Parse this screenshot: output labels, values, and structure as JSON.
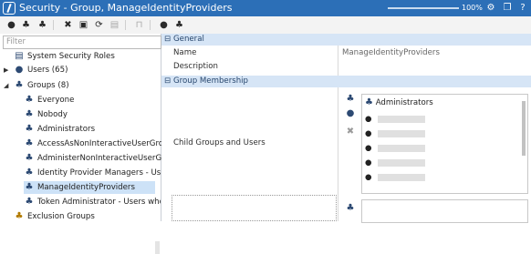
{
  "window": {
    "title": "Security - Group, ManageIdentityProviders",
    "zoom": "100%"
  },
  "toolbar": {
    "buttons": [
      {
        "name": "new-user",
        "icon": "user-icon"
      },
      {
        "name": "new-group",
        "icon": "group-icon"
      },
      {
        "name": "new-exclusion-group",
        "icon": "group-icon"
      },
      {
        "name": "delete",
        "icon": "close-icon"
      },
      {
        "name": "properties",
        "icon": "document-icon"
      },
      {
        "name": "refresh",
        "icon": "refresh-icon"
      },
      {
        "name": "save",
        "icon": "save-icon"
      },
      {
        "name": "lock",
        "icon": "lock-icon"
      },
      {
        "name": "user-settings",
        "icon": "user-icon"
      },
      {
        "name": "groups-settings",
        "icon": "group-icon"
      }
    ]
  },
  "tree": {
    "filter_placeholder": "Filter",
    "items": [
      {
        "label": "System Security Roles",
        "icon": "roles-icon"
      },
      {
        "label": "Users (65)",
        "icon": "user-icon"
      },
      {
        "label": "Groups (8)",
        "icon": "group-icon"
      },
      {
        "label": "Everyone",
        "icon": "group-icon"
      },
      {
        "label": "Nobody",
        "icon": "group-icon"
      },
      {
        "label": "Administrators",
        "icon": "group-icon"
      },
      {
        "label": "AccessAsNonInteractiveUserGroup",
        "icon": "group-icon"
      },
      {
        "label": "AdministerNonInteractiveUserGroup",
        "icon": "group-icon"
      },
      {
        "label": "Identity Provider Managers - Users wh",
        "icon": "group-icon"
      },
      {
        "label": "ManageIdentityProviders",
        "icon": "group-icon"
      },
      {
        "label": "Token Administrator - Users who will n",
        "icon": "group-icon"
      },
      {
        "label": "Exclusion Groups",
        "icon": "group-icon"
      }
    ]
  },
  "properties": {
    "general_label": "General",
    "name_label": "Name",
    "name_value": "ManageIdentityProviders",
    "description_label": "Description",
    "description_value": "",
    "membership_label": "Group Membership",
    "child_label": "Child Groups and Users",
    "child_first": "Administrators"
  }
}
